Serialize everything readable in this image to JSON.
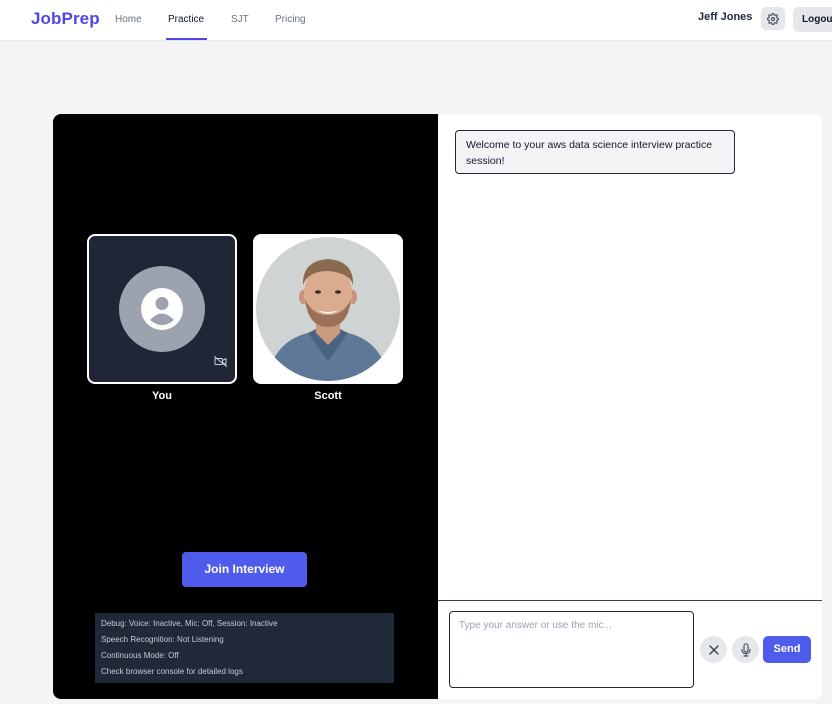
{
  "nav": {
    "brand": "JobPrep",
    "links": [
      {
        "label": "Home",
        "active": false
      },
      {
        "label": "Practice",
        "active": true
      },
      {
        "label": "SJT",
        "active": false
      },
      {
        "label": "Pricing",
        "active": false
      }
    ],
    "user_name": "Jeff Jones",
    "settings_icon": "gear-icon",
    "logout_label": "Logout"
  },
  "video": {
    "participants": [
      {
        "label": "You",
        "camera": "off",
        "icon": "user-avatar-icon"
      },
      {
        "label": "Scott",
        "camera": "on"
      }
    ],
    "join_label": "Join Interview",
    "debug_lines": [
      "Debug: Voice: Inactive, Mic: Off, Session: Inactive",
      "Speech Recognition: Not Listening",
      "Continuous Mode: Off",
      "Check browser console for detailed logs"
    ]
  },
  "chat": {
    "messages": [
      {
        "text": "Welcome to your aws data science interview practice session!"
      }
    ],
    "input_value": "",
    "input_placeholder": "Type your answer or use the mic...",
    "clear_icon": "close-icon",
    "mic_icon": "microphone-icon",
    "send_label": "Send"
  },
  "colors": {
    "brand": "#4f46e5",
    "button": "#4f5bea",
    "video_bg": "#000000",
    "tile_bg": "#202636"
  }
}
